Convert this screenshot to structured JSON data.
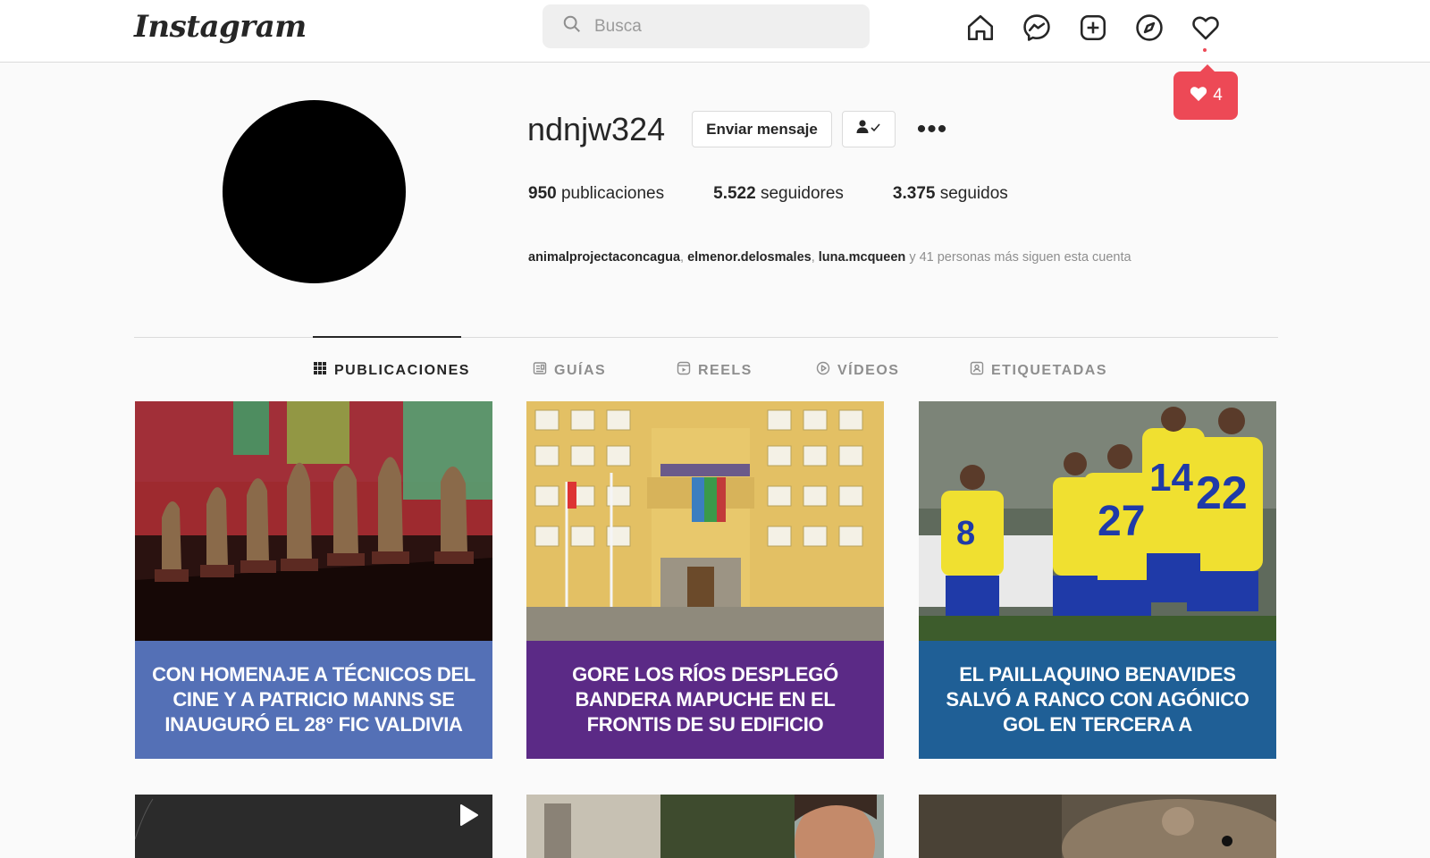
{
  "topbar": {
    "logo": "Instagram",
    "search_placeholder": "Busca",
    "icons": [
      "home-icon",
      "messenger-icon",
      "new-post-icon",
      "explore-icon",
      "activity-heart-icon"
    ],
    "notification_count": "4"
  },
  "profile": {
    "username": "ndnjw324",
    "message_button": "Enviar mensaje",
    "stats": {
      "posts_count": "950",
      "posts_label": "publicaciones",
      "followers_count": "5.522",
      "followers_label": "seguidores",
      "following_count": "3.375",
      "following_label": "seguidos"
    },
    "followed_by": {
      "users": [
        "animalprojectaconcagua",
        "elmenor.delosmales",
        "luna.mcqueen"
      ],
      "suffix": "y 41 personas más siguen esta cuenta"
    }
  },
  "tabs": [
    {
      "label": "PUBLICACIONES",
      "active": true
    },
    {
      "label": "GUÍAS",
      "active": false
    },
    {
      "label": "REELS",
      "active": false
    },
    {
      "label": "VÍDEOS",
      "active": false
    },
    {
      "label": "ETIQUETADAS",
      "active": false
    }
  ],
  "posts": [
    {
      "caption": "CON HOMENAJE A TÉCNICOS DEL CINE Y A PATRICIO MANNS SE INAUGURÓ EL 28° FIC VALDIVIA",
      "caption_color": "#5470b6"
    },
    {
      "caption": "GORE LOS RÍOS DESPLEGÓ BANDERA MAPUCHE EN EL FRONTIS DE SU EDIFICIO",
      "caption_color": "#5b2a86"
    },
    {
      "caption": "EL PAILLAQUINO BENAVIDES SALVÓ A RANCO CON AGÓNICO GOL EN TERCERA A",
      "caption_color": "#1f5f96"
    },
    {
      "caption": ""
    },
    {
      "caption": ""
    },
    {
      "caption": ""
    }
  ],
  "colors": {
    "accent_red": "#ed4956",
    "border": "#dbdbdb",
    "background": "#fafafa"
  }
}
